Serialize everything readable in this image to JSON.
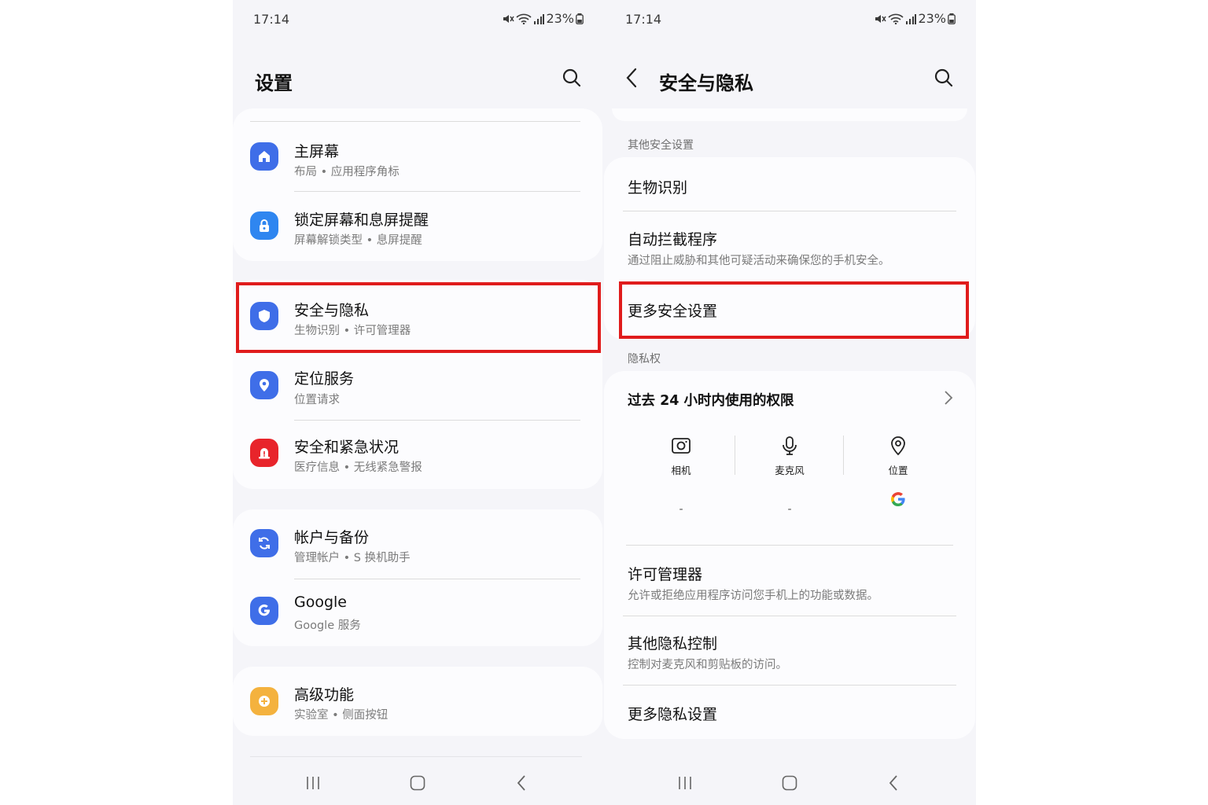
{
  "colors": {
    "highlight": "#e01c1c",
    "home_icon_bg": "#3f6ee8",
    "lock_icon_bg": "#2f86f0",
    "security_icon_bg": "#3f6ee8",
    "location_icon_bg": "#3f6ee8",
    "emergency_icon_bg": "#e8242b",
    "accounts_icon_bg": "#3f6ee8",
    "google_icon_bg": "#3f6ee8",
    "advanced_icon_bg": "#f4b23e"
  },
  "left": {
    "status": {
      "time": "17:14",
      "battery": "23%"
    },
    "title": "设置",
    "items": [
      {
        "title": "主屏幕",
        "subtitle": "布局 • 应用程序角标",
        "icon": "home-icon"
      },
      {
        "title": "锁定屏幕和息屏提醒",
        "subtitle": "屏幕解锁类型 • 息屏提醒",
        "icon": "lock-icon"
      },
      {
        "title": "安全与隐私",
        "subtitle": "生物识别 • 许可管理器",
        "icon": "shield-icon"
      },
      {
        "title": "定位服务",
        "subtitle": "位置请求",
        "icon": "location-pin-icon"
      },
      {
        "title": "安全和紧急状况",
        "subtitle": "医疗信息 • 无线紧急警报",
        "icon": "emergency-alert-icon"
      },
      {
        "title": "帐户与备份",
        "subtitle": "管理帐户 • S 换机助手",
        "icon": "sync-icon"
      },
      {
        "title": "Google",
        "subtitle": "Google 服务",
        "icon": "google-g-icon"
      },
      {
        "title": "高级功能",
        "subtitle": "实验室 • 侧面按钮",
        "icon": "gear-plus-icon"
      }
    ]
  },
  "right": {
    "status": {
      "time": "17:14",
      "battery": "23%"
    },
    "title": "安全与隐私",
    "section_other_security": "其他安全设置",
    "biometrics": "生物识别",
    "auto_blocker": {
      "title": "自动拦截程序",
      "subtitle": "通过阻止威胁和其他可疑活动来确保您的手机安全。"
    },
    "more_security": "更多安全设置",
    "section_privacy": "隐私权",
    "permissions_24h": "过去 24 小时内使用的权限",
    "perm_columns": [
      {
        "label": "相机",
        "value": "-",
        "icon": "camera-icon"
      },
      {
        "label": "麦克风",
        "value": "-",
        "icon": "microphone-icon"
      },
      {
        "label": "位置",
        "value": "",
        "icon": "location-pin-icon",
        "app_icon": "google-g-icon"
      }
    ],
    "permission_manager": {
      "title": "许可管理器",
      "subtitle": "允许或拒绝应用程序访问您手机上的功能或数据。"
    },
    "other_privacy": {
      "title": "其他隐私控制",
      "subtitle": "控制对麦克风和剪贴板的访问。"
    },
    "more_privacy": "更多隐私设置"
  }
}
